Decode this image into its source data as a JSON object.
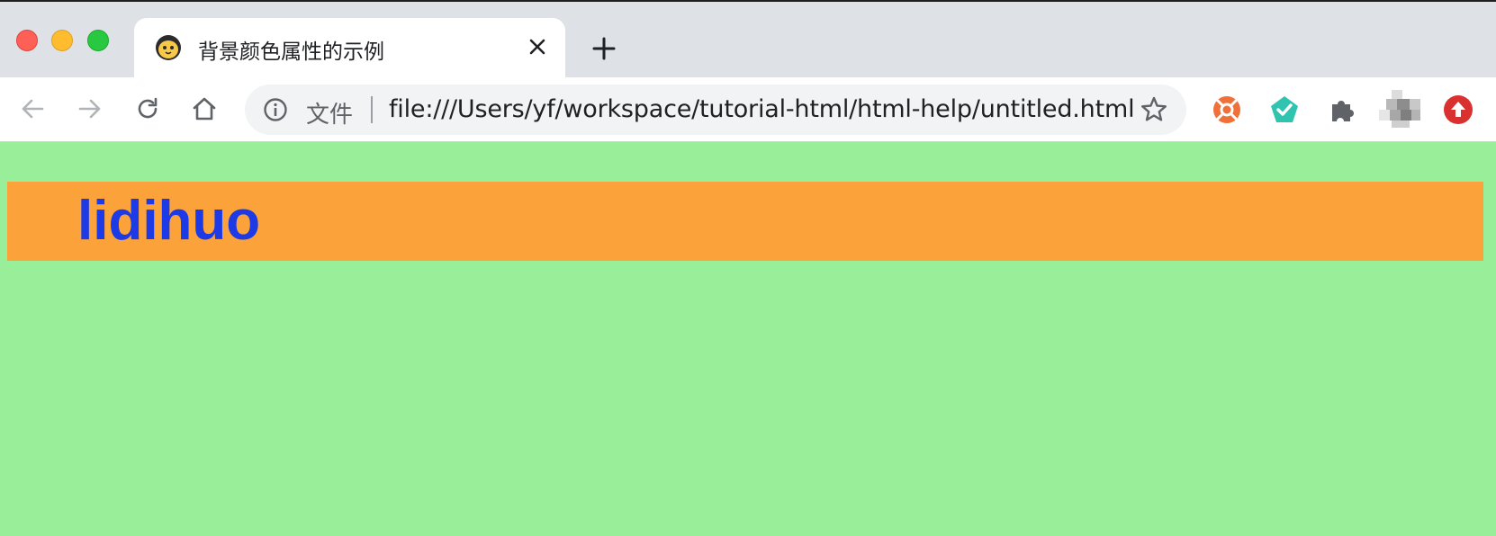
{
  "window": {
    "controls": [
      "close",
      "minimize",
      "maximize"
    ]
  },
  "tabs": [
    {
      "title": "背景颜色属性的示例",
      "favicon": "mascot-icon",
      "active": true
    }
  ],
  "toolbar": {
    "back_icon": "arrow-left-icon",
    "forward_icon": "arrow-right-icon",
    "reload_icon": "reload-icon",
    "home_icon": "home-icon"
  },
  "omnibox": {
    "scheme_label": "文件",
    "url": "file:///Users/yf/workspace/tutorial-html/html-help/untitled.html",
    "info_icon": "info-icon",
    "bookmark_icon": "star-icon"
  },
  "extensions": [
    {
      "name": "lifebuoy-icon",
      "color": "#f0703a"
    },
    {
      "name": "check-pentagon-icon",
      "color": "#2ec4b0"
    },
    {
      "name": "puzzle-icon",
      "color": "#5f6368"
    },
    {
      "name": "avatar",
      "color": "#9a9a9a"
    },
    {
      "name": "upload-icon",
      "color": "#d93030"
    }
  ],
  "page": {
    "background_color": "#99ee99",
    "heading": {
      "text": "lidihuo",
      "background_color": "#fba23b",
      "text_color": "#1c3ae6"
    }
  }
}
